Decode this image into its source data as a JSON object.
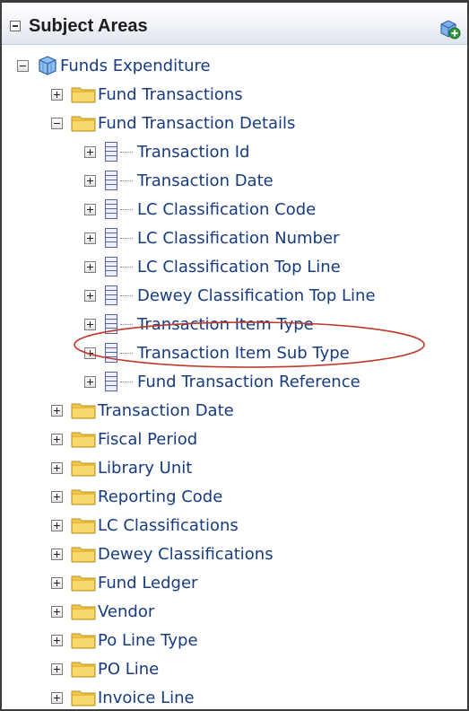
{
  "panel": {
    "title": "Subject Areas"
  },
  "tree": {
    "root": {
      "label": "Funds Expenditure",
      "expanded": true
    },
    "folders": [
      {
        "label": "Fund Transactions",
        "expanded": false
      },
      {
        "label": "Fund Transaction Details",
        "expanded": true,
        "columns": [
          "Transaction Id",
          "Transaction Date",
          "LC Classification Code",
          "LC Classification Number",
          "LC Classification Top Line",
          "Dewey Classification Top Line",
          "Transaction Item Type",
          "Transaction Item Sub Type",
          "Fund Transaction Reference"
        ]
      },
      {
        "label": "Transaction Date",
        "expanded": false
      },
      {
        "label": "Fiscal Period",
        "expanded": false
      },
      {
        "label": "Library Unit",
        "expanded": false
      },
      {
        "label": "Reporting Code",
        "expanded": false
      },
      {
        "label": "LC Classifications",
        "expanded": false
      },
      {
        "label": "Dewey Classifications",
        "expanded": false
      },
      {
        "label": "Fund Ledger",
        "expanded": false
      },
      {
        "label": "Vendor",
        "expanded": false
      },
      {
        "label": "Po Line Type",
        "expanded": false
      },
      {
        "label": "PO Line",
        "expanded": false
      },
      {
        "label": "Invoice Line",
        "expanded": false
      }
    ]
  },
  "colors": {
    "label_text": "#173b80",
    "highlight_ellipse": "#c0392b",
    "folder": "#f2c94c"
  },
  "icons": {
    "header_action": "add-subject-area-icon",
    "root": "cube-icon",
    "folder": "folder-icon",
    "column": "column-icon"
  }
}
